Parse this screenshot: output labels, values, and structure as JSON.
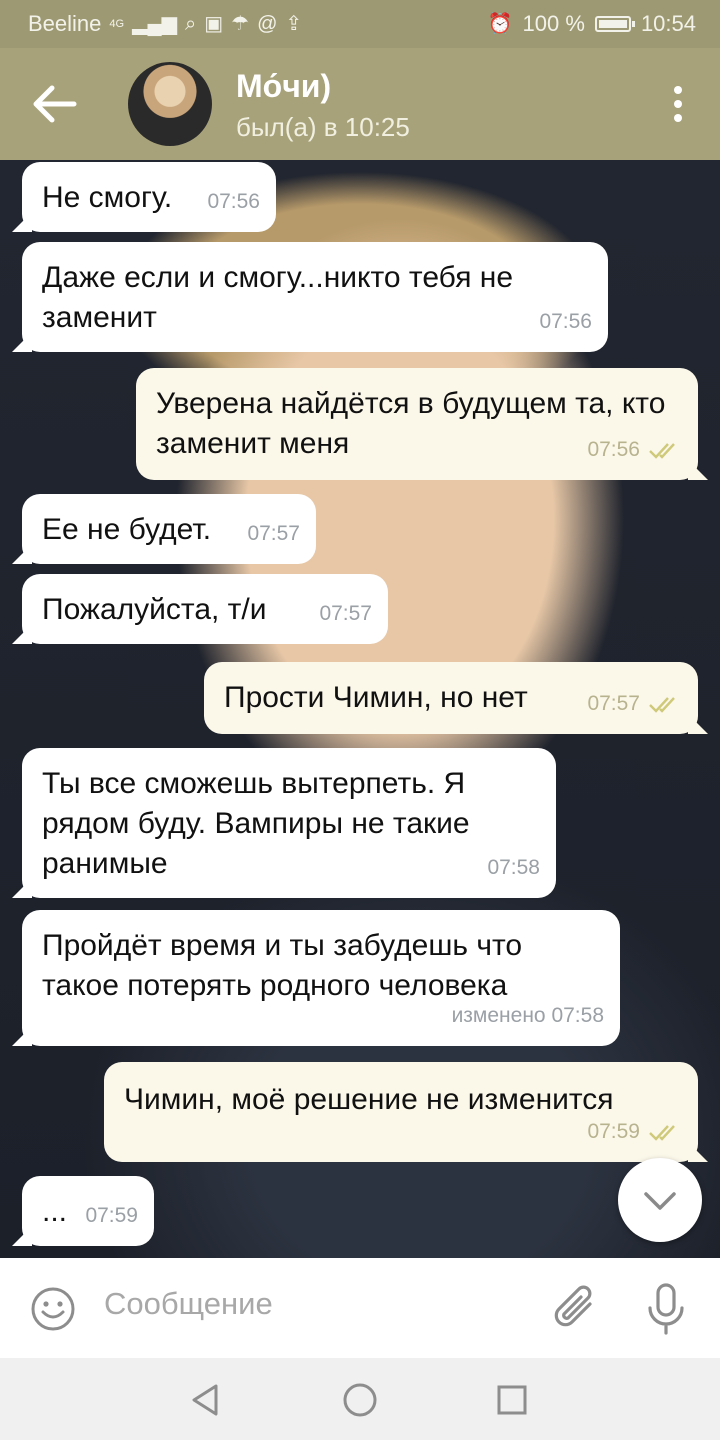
{
  "status_bar": {
    "carrier": "Beeline",
    "network": "4G",
    "battery": "100 %",
    "time": "10:54"
  },
  "header": {
    "contact_name": "Мо́чи)",
    "last_seen": "был(а) в 10:25"
  },
  "messages": [
    {
      "direction": "in",
      "text": "Не смогу.",
      "time": "07:56"
    },
    {
      "direction": "in",
      "text": "Даже если и смогу...никто тебя не заменит",
      "time": "07:56"
    },
    {
      "direction": "out",
      "text": "Уверена найдётся в будущем та, кто заменит меня",
      "time": "07:56",
      "read": true
    },
    {
      "direction": "in",
      "text": "Ее не будет.",
      "time": "07:57"
    },
    {
      "direction": "in",
      "text": "Пожалуйста, т/и",
      "time": "07:57"
    },
    {
      "direction": "out",
      "text": "Прости Чимин, но нет",
      "time": "07:57",
      "read": true
    },
    {
      "direction": "in",
      "text": "Ты все сможешь вытерпеть. Я рядом буду. Вампиры не такие ранимые",
      "time": "07:58"
    },
    {
      "direction": "in",
      "text": "Пройдёт  время и ты забудешь что такое потерять родного человека",
      "time": "изменено 07:58"
    },
    {
      "direction": "out",
      "text": "Чимин, моё решение не изменится",
      "time": "07:59",
      "read": true
    },
    {
      "direction": "in",
      "text": "...",
      "time": "07:59"
    }
  ],
  "input": {
    "placeholder": "Сообщение"
  },
  "colors": {
    "header": "#a8a27a",
    "status_bar": "#9d9a73",
    "incoming_bubble": "#ffffff",
    "outgoing_bubble": "#fbf8ea",
    "read_check": "#cfc97a"
  },
  "icons": [
    "back-arrow-icon",
    "more-vert-icon",
    "double-check-icon",
    "chevron-down-icon",
    "emoji-icon",
    "attach-icon",
    "mic-icon",
    "nav-back-icon",
    "nav-home-icon",
    "nav-recents-icon"
  ]
}
